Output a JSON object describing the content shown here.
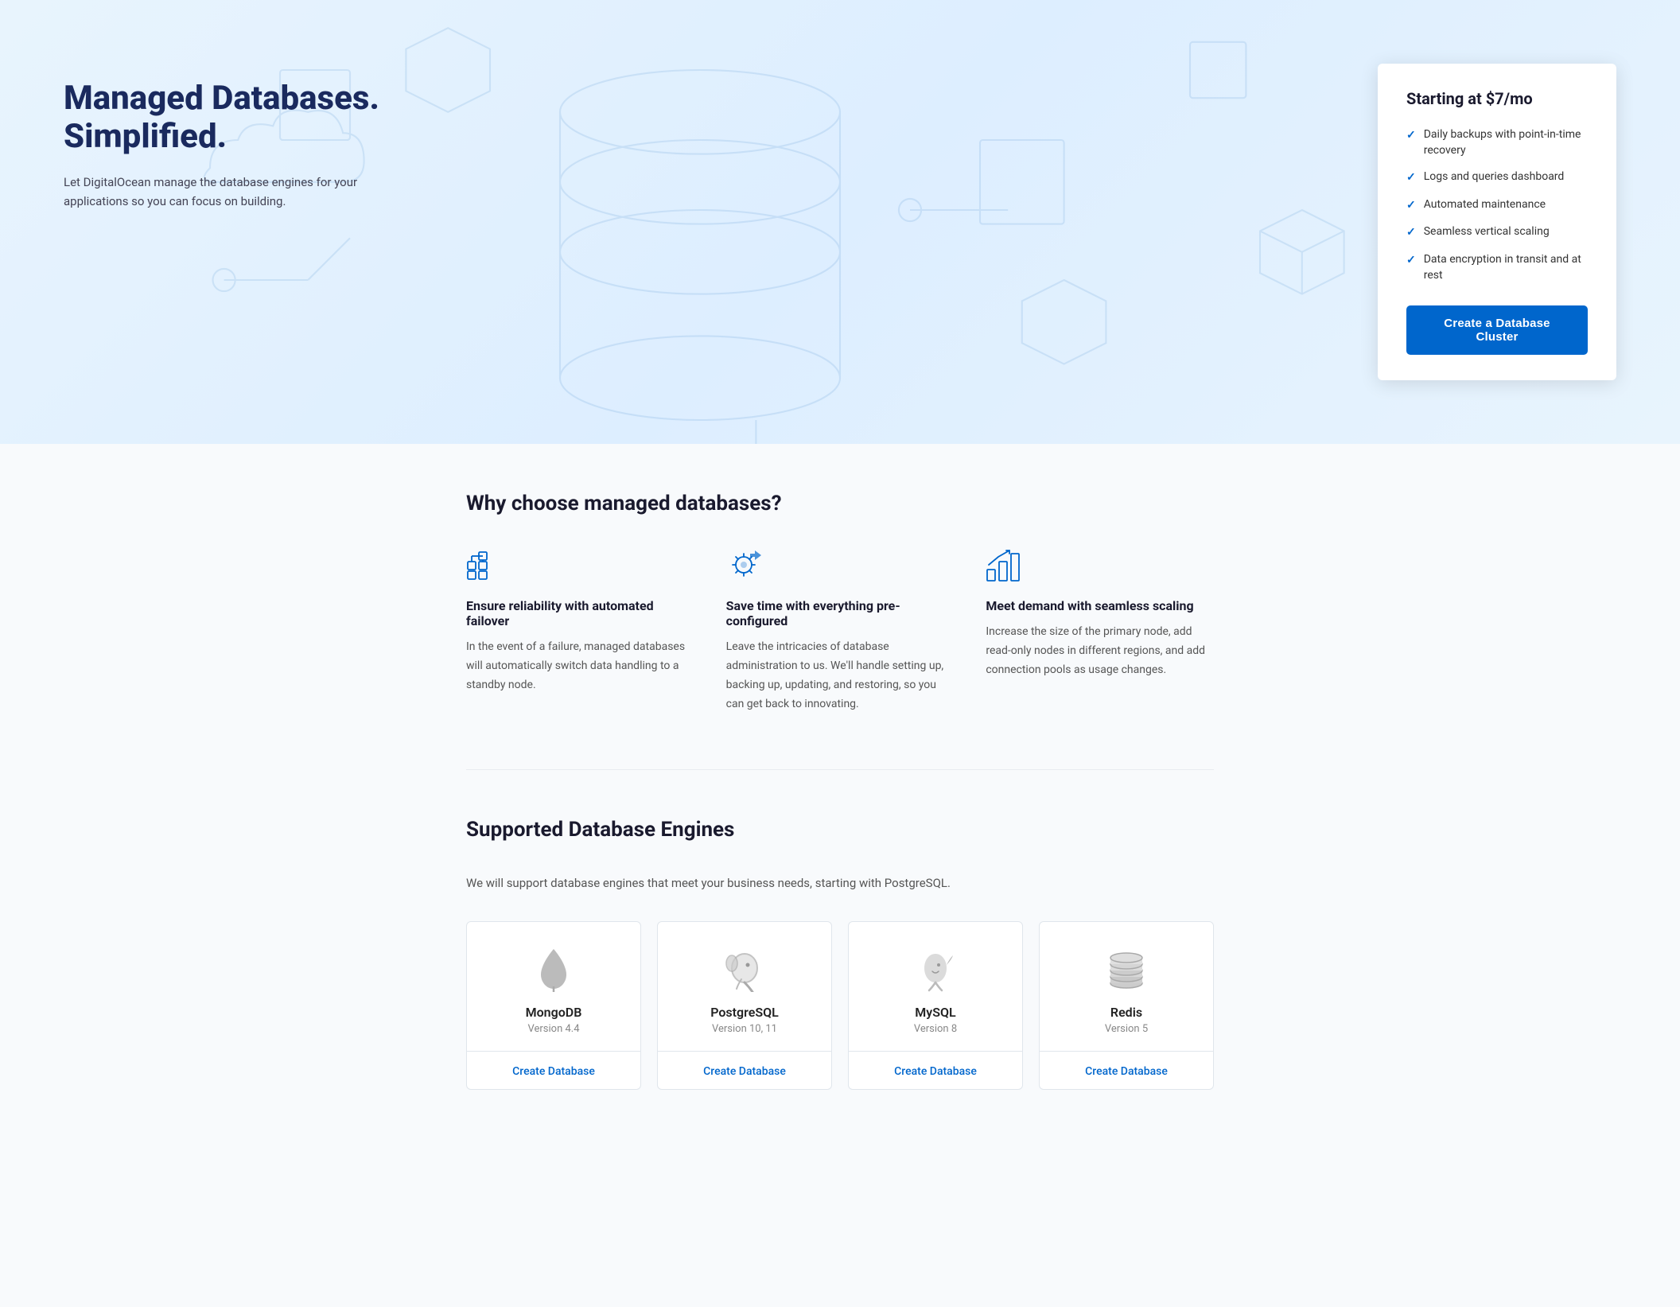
{
  "hero": {
    "title": "Managed Databases. Simplified.",
    "subtitle": "Let DigitalOcean manage the database engines for your applications so you can focus on building.",
    "pricing": {
      "label": "Starting at $7/mo",
      "features": [
        "Daily backups with point-in-time recovery",
        "Logs and queries dashboard",
        "Automated maintenance",
        "Seamless vertical scaling",
        "Data encryption in transit and at rest"
      ],
      "cta": "Create a Database Cluster"
    }
  },
  "why_section": {
    "title": "Why choose managed databases?",
    "features": [
      {
        "title": "Ensure reliability with automated failover",
        "description": "In the event of a failure, managed databases will automatically switch data handling to a standby node."
      },
      {
        "title": "Save time with everything pre-configured",
        "description": "Leave the intricacies of database administration to us. We'll handle setting up, backing up, updating, and restoring, so you can get back to innovating."
      },
      {
        "title": "Meet demand with seamless scaling",
        "description": "Increase the size of the primary node, add read-only nodes in different regions, and add connection pools as usage changes."
      }
    ]
  },
  "engines_section": {
    "title": "Supported Database Engines",
    "subtitle": "We will support database engines that meet your business needs, starting with PostgreSQL.",
    "engines": [
      {
        "name": "MongoDB",
        "version": "Version 4.4",
        "cta": "Create Database",
        "icon": "mongodb"
      },
      {
        "name": "PostgreSQL",
        "version": "Version 10, 11",
        "cta": "Create Database",
        "icon": "postgresql"
      },
      {
        "name": "MySQL",
        "version": "Version 8",
        "cta": "Create Database",
        "icon": "mysql"
      },
      {
        "name": "Redis",
        "version": "Version 5",
        "cta": "Create Database",
        "icon": "redis"
      }
    ]
  }
}
